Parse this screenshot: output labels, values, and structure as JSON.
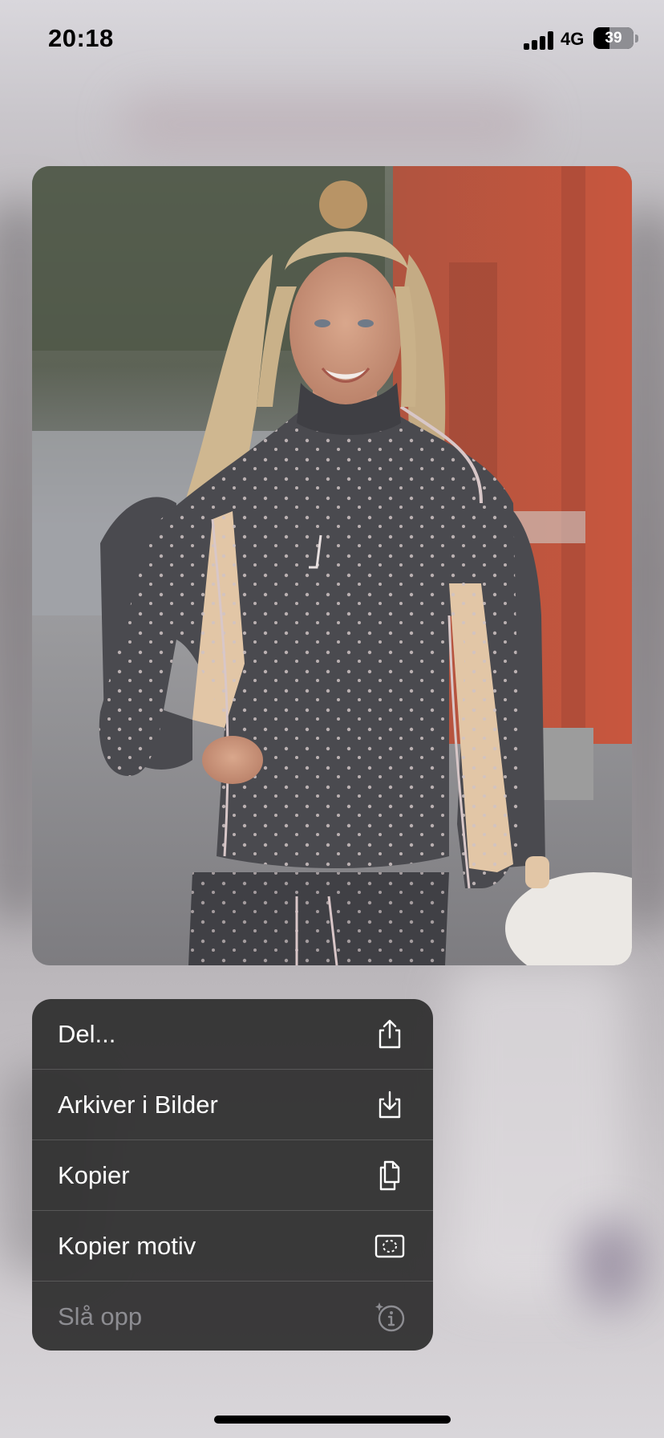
{
  "status_bar": {
    "time": "20:18",
    "network": "4G",
    "battery_level": "39"
  },
  "preview": {
    "icon": "photo-preview"
  },
  "context_menu": {
    "items": [
      {
        "label": "Del...",
        "icon": "share-icon",
        "enabled": true
      },
      {
        "label": "Arkiver i Bilder",
        "icon": "save-to-photos-icon",
        "enabled": true
      },
      {
        "label": "Kopier",
        "icon": "copy-icon",
        "enabled": true
      },
      {
        "label": "Kopier motiv",
        "icon": "copy-subject-icon",
        "enabled": true
      },
      {
        "label": "Slå opp",
        "icon": "visual-lookup-icon",
        "enabled": false
      }
    ]
  },
  "colors": {
    "menu_background": "#303030",
    "menu_text": "#ffffff",
    "menu_text_disabled": "#8d8d92"
  }
}
